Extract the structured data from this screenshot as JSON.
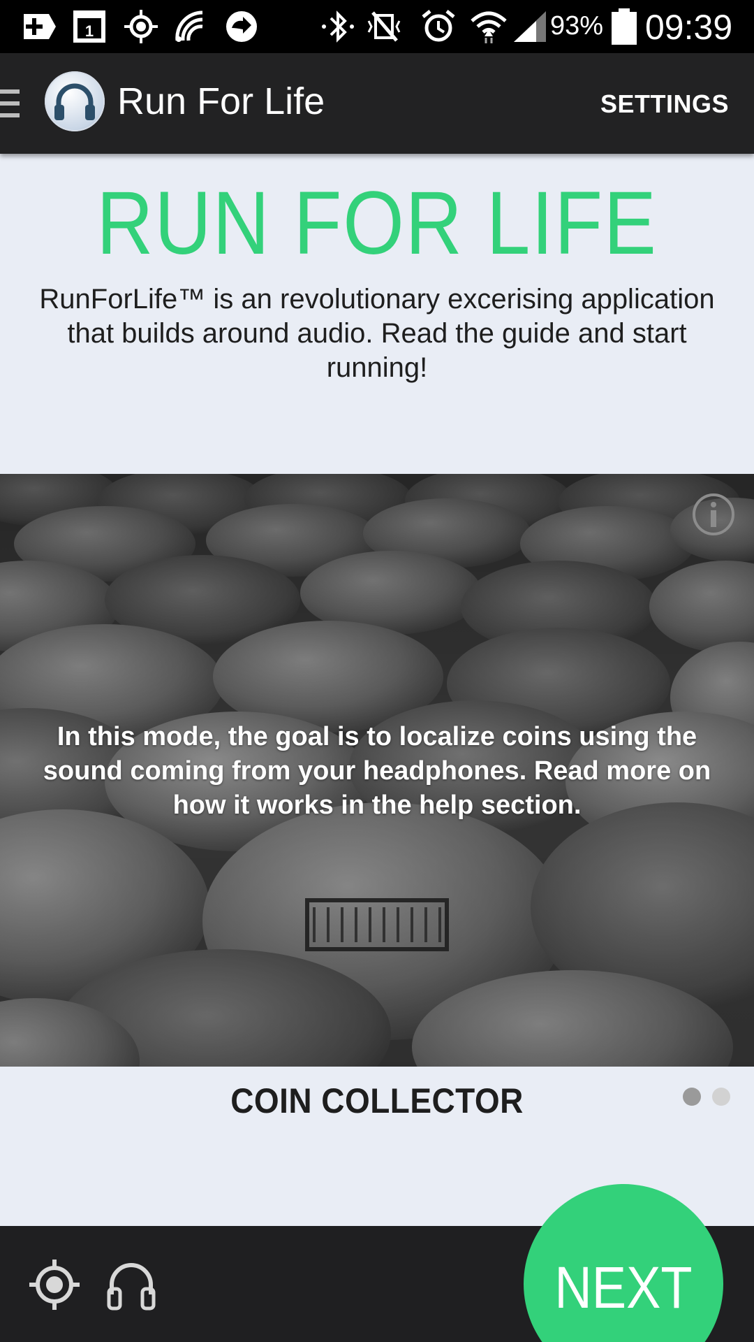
{
  "status_bar": {
    "battery": "93%",
    "time": "09:39",
    "icons": [
      "add-box-icon",
      "calendar-icon",
      "gps-icon",
      "nfc-icon",
      "sync-arrow-icon",
      "bluetooth-icon",
      "vibrate-mute-icon",
      "alarm-icon",
      "wifi-icon",
      "signal-icon",
      "battery-icon"
    ]
  },
  "action_bar": {
    "title": "Run For Life",
    "settings_label": "SETTINGS"
  },
  "header": {
    "title": "RUN FOR LIFE",
    "intro": "RunForLife™ is an revolutionary excerising application that builds around audio. Read the guide and start running!"
  },
  "mode_card": {
    "description": "In this mode, the goal is to localize coins using the sound coming from your headphones. Read more on how it works in the help section.",
    "title": "COIN COLLECTOR",
    "page_count": 2,
    "current_page": 1
  },
  "bottom_bar": {
    "next_label": "NEXT"
  },
  "colors": {
    "accent": "#33d17a",
    "action_bar": "#222223",
    "page_background": "#e9edf5"
  }
}
